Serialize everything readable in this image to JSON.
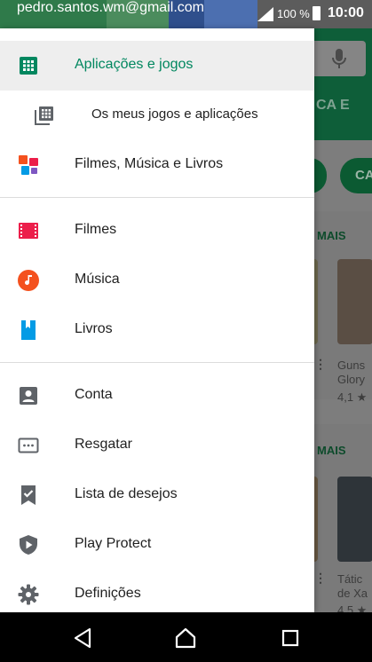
{
  "status_bar": {
    "account_email": "pedro.santos.wm@gmail.com",
    "battery_percent": "100 %",
    "time": "10:00"
  },
  "drawer": {
    "items": [
      {
        "label": "Aplicações e jogos",
        "icon": "apps-grid-icon",
        "selected": true
      },
      {
        "label": "Os meus jogos e aplicações",
        "icon": "my-apps-grid-icon"
      },
      {
        "label": "Filmes, Música e Livros",
        "icon": "entertainment-icon"
      },
      {
        "label": "Filmes",
        "icon": "movies-icon"
      },
      {
        "label": "Música",
        "icon": "music-icon"
      },
      {
        "label": "Livros",
        "icon": "books-icon"
      },
      {
        "label": "Conta",
        "icon": "account-icon"
      },
      {
        "label": "Resgatar",
        "icon": "redeem-icon"
      },
      {
        "label": "Lista de desejos",
        "icon": "wishlist-icon"
      },
      {
        "label": "Play Protect",
        "icon": "play-protect-icon"
      },
      {
        "label": "Definições",
        "icon": "settings-icon"
      }
    ]
  },
  "background": {
    "tab_fragment": "CA E",
    "chip_fragment": "CA",
    "section_more_1": "MAIS",
    "section_more_2": "MAIS",
    "card_title_1": "Guns",
    "card_title_1b": "Glory",
    "card_rating_1": "4,1 ★",
    "card_title_2": "Tátic",
    "card_title_2b": "de Xa",
    "card_rating_2": "4,5 ★"
  },
  "colors": {
    "accent_green": "#01875f",
    "movies_red": "#ec1e4a",
    "music_orange": "#f4511e",
    "books_blue": "#039be5",
    "icon_gray": "#5f6368"
  },
  "nav_bar": {
    "back": "back-icon",
    "home": "home-icon",
    "recents": "recents-icon"
  }
}
